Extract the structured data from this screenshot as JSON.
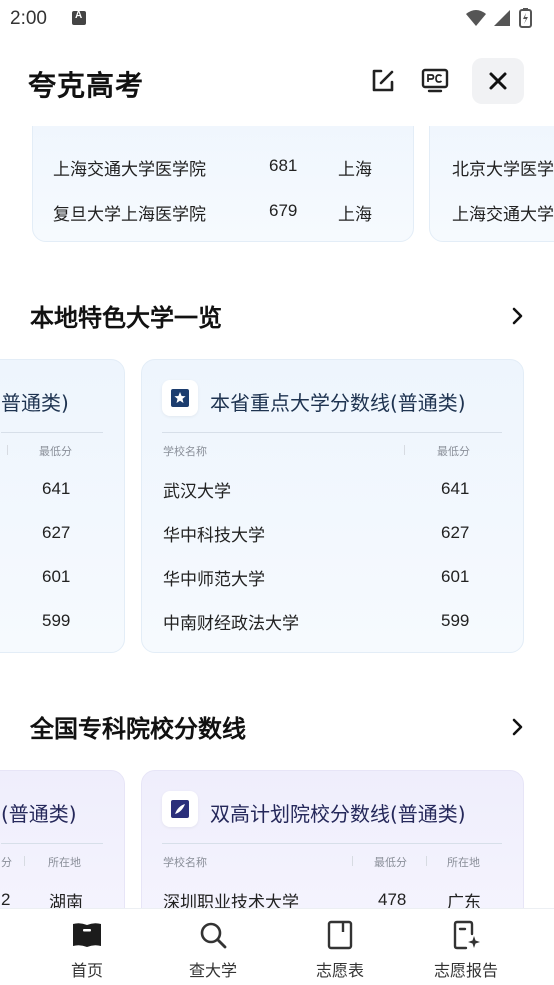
{
  "status_bar": {
    "time": "2:00"
  },
  "header": {
    "title": "夸克高考"
  },
  "top_cards": {
    "left_rows": [
      {
        "name": "上海交通大学医学院",
        "score": "681",
        "location": "上海"
      },
      {
        "name": "复旦大学上海医学院",
        "score": "679",
        "location": "上海"
      }
    ],
    "right_rows": [
      {
        "name": "北京大学医学"
      },
      {
        "name": "上海交通大学"
      }
    ]
  },
  "section_local": {
    "title": "本地特色大学一览",
    "left_card": {
      "title_fragment": "普通类)",
      "col_min": "最低分",
      "scores": [
        "641",
        "627",
        "601",
        "599"
      ]
    },
    "main_card": {
      "title": "本省重点大学分数线(普通类)",
      "col_school": "学校名称",
      "col_min": "最低分",
      "rows": [
        {
          "name": "武汉大学",
          "score": "641"
        },
        {
          "name": "华中科技大学",
          "score": "627"
        },
        {
          "name": "华中师范大学",
          "score": "601"
        },
        {
          "name": "中南财经政法大学",
          "score": "599"
        }
      ]
    }
  },
  "section_vocational": {
    "title": "全国专科院校分数线",
    "left_card": {
      "title_fragment": "(普通类)",
      "col_min_fragment": "分",
      "col_location": "所在地",
      "row_score_fragment": "2",
      "row_location": "湖南"
    },
    "main_card": {
      "title": "双高计划院校分数线(普通类)",
      "col_school": "学校名称",
      "col_min": "最低分",
      "col_location": "所在地",
      "rows": [
        {
          "name": "深圳职业技术大学",
          "score": "478",
          "location": "广东"
        }
      ]
    }
  },
  "bottom_nav": [
    {
      "label": "首页"
    },
    {
      "label": "查大学"
    },
    {
      "label": "志愿表"
    },
    {
      "label": "志愿报告"
    }
  ]
}
